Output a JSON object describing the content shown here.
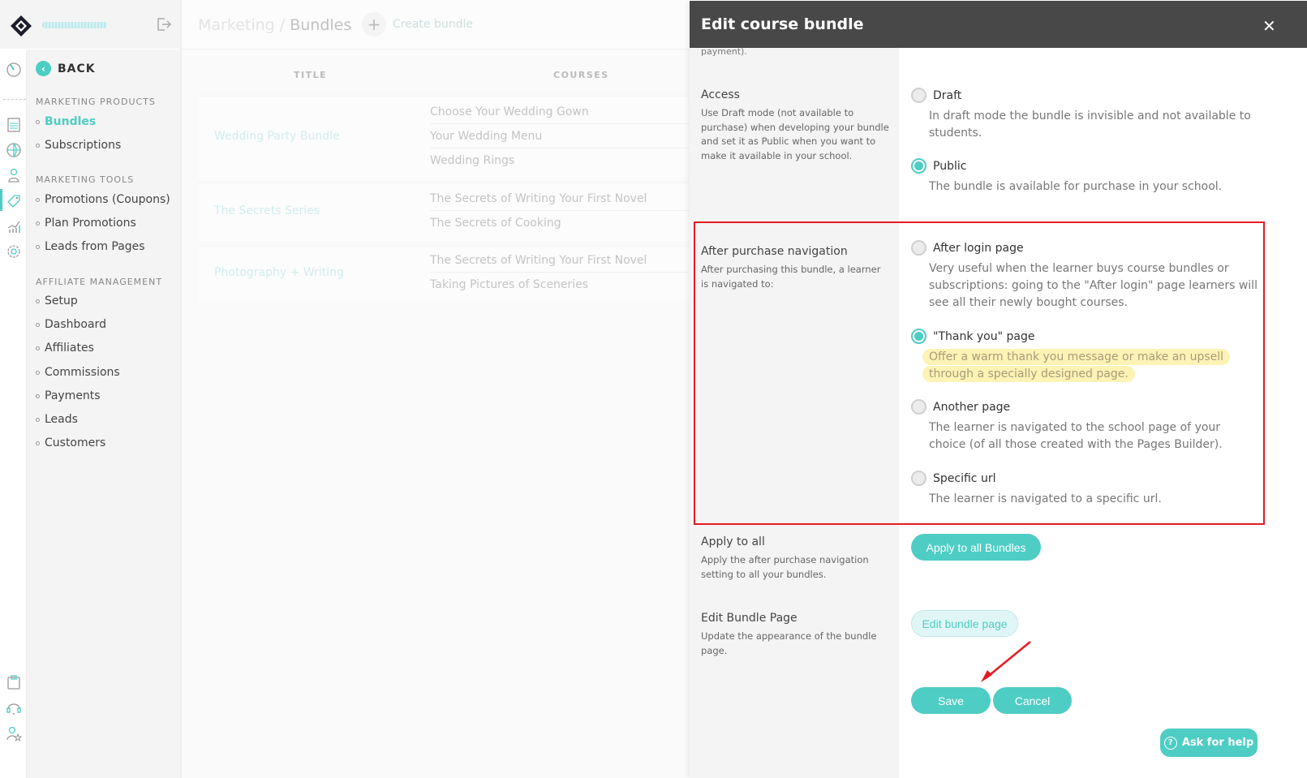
{
  "sidebar": {
    "back_label": "BACK",
    "sections": [
      {
        "title": "MARKETING PRODUCTS",
        "items": [
          {
            "label": "Bundles",
            "active": true
          },
          {
            "label": "Subscriptions"
          }
        ]
      },
      {
        "title": "MARKETING TOOLS",
        "items": [
          {
            "label": "Promotions (Coupons)"
          },
          {
            "label": "Plan Promotions"
          },
          {
            "label": "Leads from Pages"
          }
        ]
      },
      {
        "title": "AFFILIATE MANAGEMENT",
        "items": [
          {
            "label": "Setup"
          },
          {
            "label": "Dashboard"
          },
          {
            "label": "Affiliates"
          },
          {
            "label": "Commissions"
          },
          {
            "label": "Payments"
          },
          {
            "label": "Leads"
          },
          {
            "label": "Customers"
          }
        ]
      }
    ]
  },
  "rail_icons": [
    "speedometer-icon",
    "courses-list-icon",
    "globe-icon",
    "users-icon",
    "tag-icon",
    "analytics-icon",
    "settings-icon",
    "clipboard-icon",
    "headset-icon",
    "user-star-icon"
  ],
  "main": {
    "breadcrumb": {
      "parent": "Marketing",
      "separator": "/",
      "current": "Bundles"
    },
    "create_label": "Create bundle",
    "columns": [
      "TITLE",
      "COURSES"
    ],
    "bundles": [
      {
        "title": "Wedding Party Bundle",
        "courses": [
          "Choose Your Wedding Gown",
          "Your Wedding Menu",
          "Wedding Rings"
        ]
      },
      {
        "title": "The Secrets Series",
        "courses": [
          "The Secrets of Writing Your First Novel",
          "The Secrets of Cooking"
        ]
      },
      {
        "title": "Photography + Writing",
        "courses": [
          "The Secrets of Writing Your First Novel",
          "Taking Pictures of Sceneries"
        ]
      }
    ]
  },
  "drawer": {
    "title": "Edit course bundle",
    "close": "✕",
    "truncated_text": "payment).",
    "access": {
      "heading": "Access",
      "description": "Use Draft mode (not available to purchase) when developing your bundle and set it as Public when you want to make it available in your school.",
      "options": [
        {
          "name": "Draft",
          "desc": "In draft mode the bundle is invisible and not available to students.",
          "selected": false
        },
        {
          "name": "Public",
          "desc": "The bundle is available for purchase in your school.",
          "selected": true
        }
      ]
    },
    "navigation": {
      "heading": "After purchase navigation",
      "description": "After purchasing this bundle, a learner is navigated to:",
      "options": [
        {
          "name": "After login page",
          "desc": "Very useful when the learner buys course bundles or subscriptions: going to the \"After login\" page learners will see all their newly bought courses.",
          "selected": false
        },
        {
          "name": "\"Thank you\" page",
          "desc": "Offer a warm thank you message or make an upsell through a specially designed page.",
          "selected": true
        },
        {
          "name": "Another page",
          "desc": "The learner is navigated to the school page of your choice (of all those created with the Pages Builder).",
          "selected": false
        },
        {
          "name": "Specific url",
          "desc": "The learner is navigated to a specific url.",
          "selected": false
        }
      ]
    },
    "apply_all": {
      "heading": "Apply to all",
      "description": "Apply the after purchase navigation setting to all your bundles.",
      "button": "Apply to all Bundles"
    },
    "edit_page": {
      "heading": "Edit Bundle Page",
      "description": "Update the appearance of the bundle page.",
      "button": "Edit bundle page"
    },
    "save_label": "Save",
    "cancel_label": "Cancel",
    "help_label": "Ask for help"
  },
  "colors": {
    "accent": "#4ecdc4",
    "header": "#484848",
    "annotation": "#e41b23",
    "highlight": "#fdf3b5"
  }
}
